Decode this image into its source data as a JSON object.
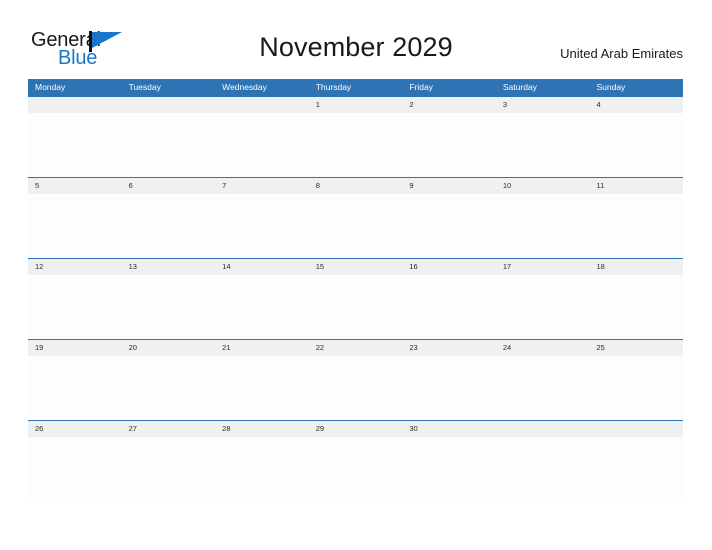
{
  "logo": {
    "word_one": "General",
    "word_two": "Blue",
    "flag_icon": "flag-icon",
    "brand_color": "#1877c9"
  },
  "header": {
    "title": "November 2029",
    "region": "United Arab Emirates"
  },
  "calendar": {
    "header_bg": "#2e73b3",
    "band_bg": "#f0f0f0",
    "divider_color": "#2e73b3",
    "weekdays": [
      "Monday",
      "Tuesday",
      "Wednesday",
      "Thursday",
      "Friday",
      "Saturday",
      "Sunday"
    ],
    "weeks": [
      {
        "days": [
          "",
          "",
          "",
          "1",
          "2",
          "3",
          "4"
        ]
      },
      {
        "days": [
          "5",
          "6",
          "7",
          "8",
          "9",
          "10",
          "11"
        ]
      },
      {
        "days": [
          "12",
          "13",
          "14",
          "15",
          "16",
          "17",
          "18"
        ]
      },
      {
        "days": [
          "19",
          "20",
          "21",
          "22",
          "23",
          "24",
          "25"
        ]
      },
      {
        "days": [
          "26",
          "27",
          "28",
          "29",
          "30",
          "",
          ""
        ]
      }
    ]
  }
}
